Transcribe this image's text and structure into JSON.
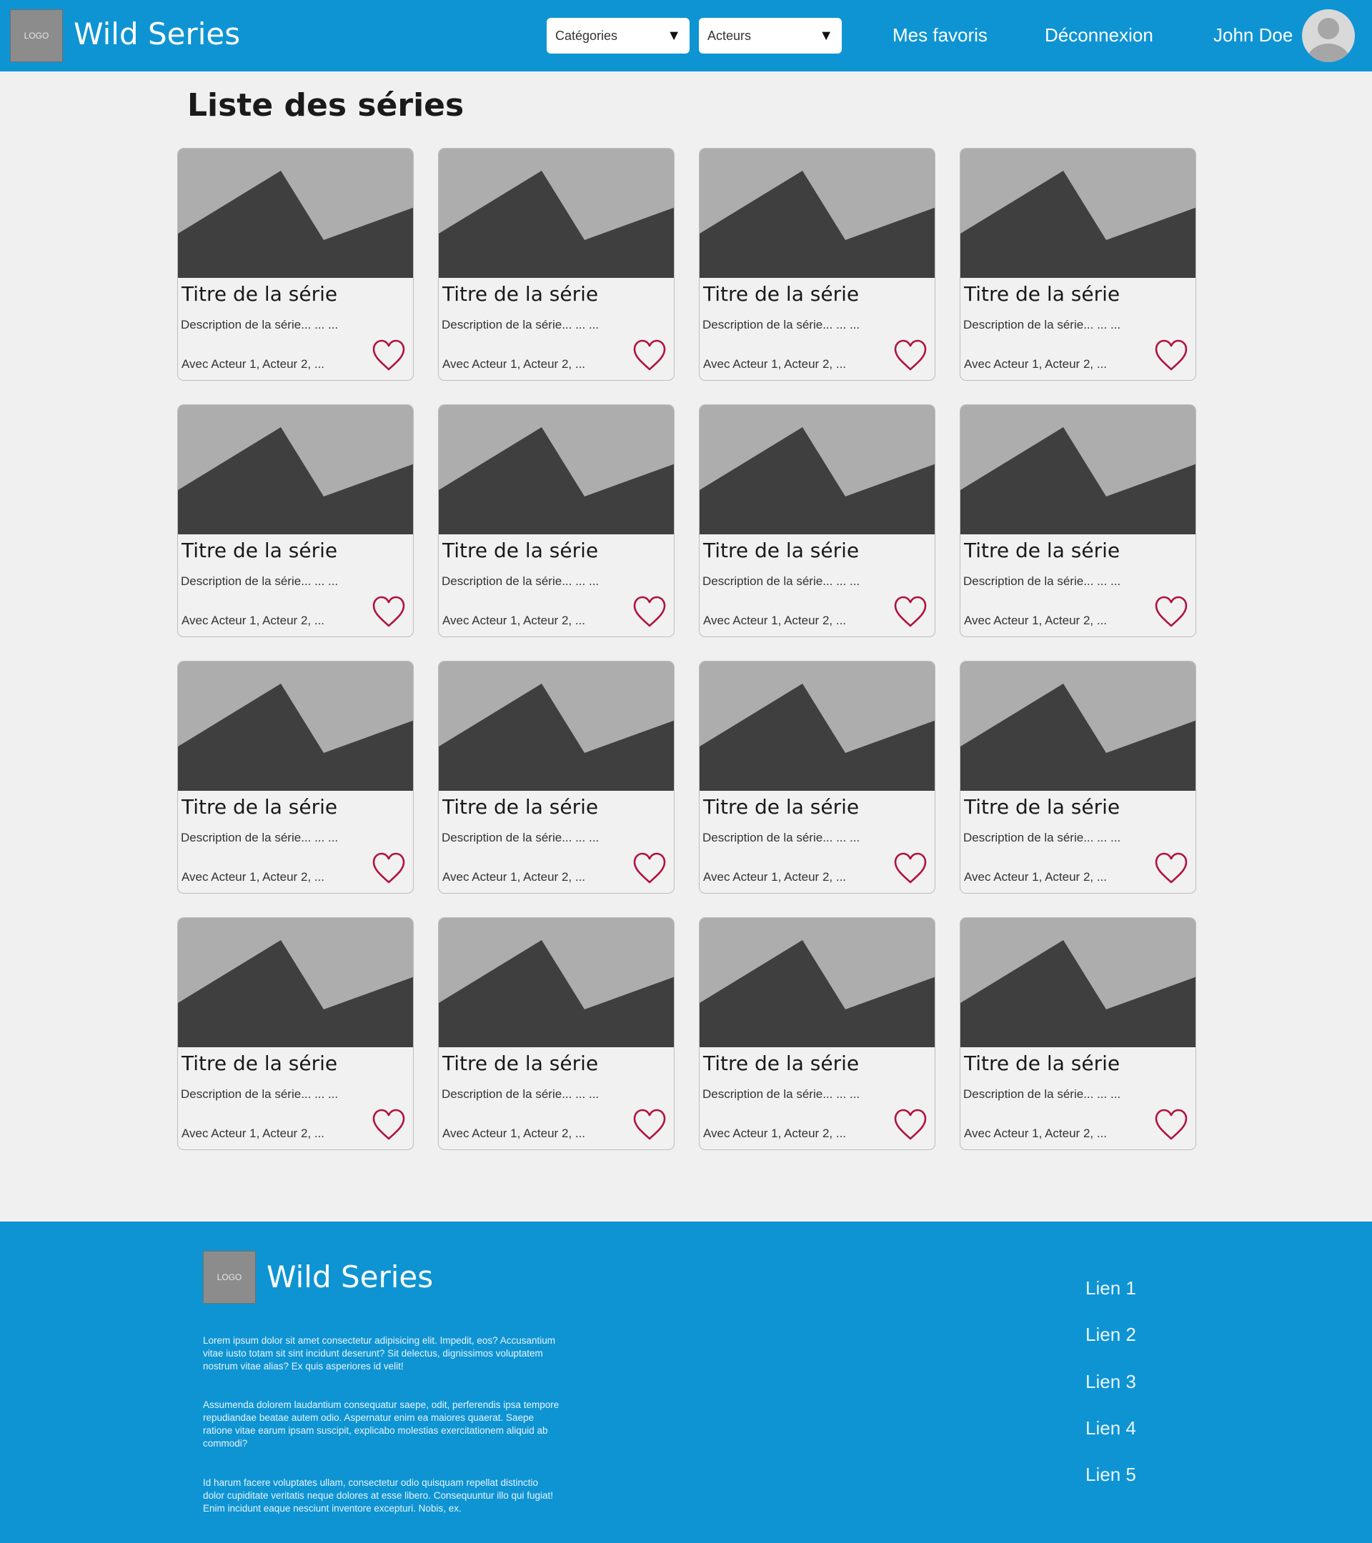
{
  "header": {
    "logo": "LOGO",
    "brand": "Wild Series",
    "categories_select": "Catégories",
    "actors_select": "Acteurs",
    "favorites_link": "Mes favoris",
    "logout_link": "Déconnexion",
    "user_name": "John Doe"
  },
  "main": {
    "title": "Liste des séries",
    "cards": [
      {
        "title": "Titre de la série",
        "description": "Description de la série... ... ...",
        "actors": "Avec Acteur 1, Acteur 2, ..."
      },
      {
        "title": "Titre de la série",
        "description": "Description de la série... ... ...",
        "actors": "Avec Acteur 1, Acteur 2, ..."
      },
      {
        "title": "Titre de la série",
        "description": "Description de la série... ... ...",
        "actors": "Avec Acteur 1, Acteur 2, ..."
      },
      {
        "title": "Titre de la série",
        "description": "Description de la série... ... ...",
        "actors": "Avec Acteur 1, Acteur 2, ..."
      },
      {
        "title": "Titre de la série",
        "description": "Description de la série... ... ...",
        "actors": "Avec Acteur 1, Acteur 2, ..."
      },
      {
        "title": "Titre de la série",
        "description": "Description de la série... ... ...",
        "actors": "Avec Acteur 1, Acteur 2, ..."
      },
      {
        "title": "Titre de la série",
        "description": "Description de la série... ... ...",
        "actors": "Avec Acteur 1, Acteur 2, ..."
      },
      {
        "title": "Titre de la série",
        "description": "Description de la série... ... ...",
        "actors": "Avec Acteur 1, Acteur 2, ..."
      },
      {
        "title": "Titre de la série",
        "description": "Description de la série... ... ...",
        "actors": "Avec Acteur 1, Acteur 2, ..."
      },
      {
        "title": "Titre de la série",
        "description": "Description de la série... ... ...",
        "actors": "Avec Acteur 1, Acteur 2, ..."
      },
      {
        "title": "Titre de la série",
        "description": "Description de la série... ... ...",
        "actors": "Avec Acteur 1, Acteur 2, ..."
      },
      {
        "title": "Titre de la série",
        "description": "Description de la série... ... ...",
        "actors": "Avec Acteur 1, Acteur 2, ..."
      },
      {
        "title": "Titre de la série",
        "description": "Description de la série... ... ...",
        "actors": "Avec Acteur 1, Acteur 2, ..."
      },
      {
        "title": "Titre de la série",
        "description": "Description de la série... ... ...",
        "actors": "Avec Acteur 1, Acteur 2, ..."
      },
      {
        "title": "Titre de la série",
        "description": "Description de la série... ... ...",
        "actors": "Avec Acteur 1, Acteur 2, ..."
      },
      {
        "title": "Titre de la série",
        "description": "Description de la série... ... ...",
        "actors": "Avec Acteur 1, Acteur 2, ..."
      }
    ]
  },
  "footer": {
    "logo": "LOGO",
    "brand": "Wild Series",
    "paragraphs": [
      "Lorem ipsum dolor sit amet consectetur adipisicing elit. Impedit, eos? Accusantium vitae iusto totam sit sint incidunt deserunt? Sit delectus, dignissimos voluptatem nostrum vitae alias? Ex quis asperiores id velit!",
      "Assumenda dolorem laudantium consequatur saepe, odit, perferendis ipsa tempore repudiandae beatae autem odio. Aspernatur enim ea maiores quaerat. Saepe ratione vitae earum ipsam suscipit, explicabo molestias exercitationem aliquid ab commodi?",
      "Id harum facere voluptates ullam, consectetur odio quisquam repellat distinctio dolor cupiditate veritatis neque dolores at esse libero. Consequuntur illo qui fugiat! Enim incidunt eaque nesciunt inventore excepturi. Nobis, ex."
    ],
    "links": [
      "Lien 1",
      "Lien 2",
      "Lien 3",
      "Lien 4",
      "Lien 5"
    ]
  },
  "icons": {
    "dropdown": "caret-down-icon",
    "favorite": "heart-outline-icon",
    "avatar": "user-avatar-icon",
    "thumbnail": "image-placeholder-icon"
  },
  "colors": {
    "brand_blue": "#0e94d3",
    "heart": "#b0123e",
    "placeholder_light": "#adadad",
    "placeholder_dark": "#3f3f3f"
  }
}
